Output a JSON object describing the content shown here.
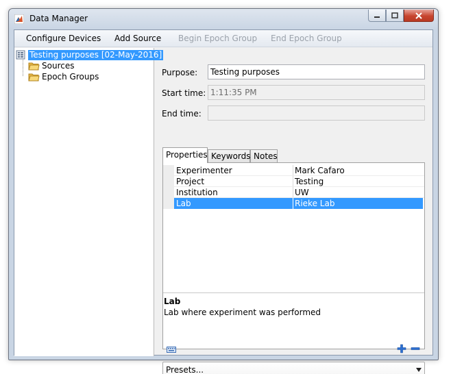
{
  "window": {
    "title": "Data Manager"
  },
  "menu": {
    "configure_devices": "Configure Devices",
    "add_source": "Add Source",
    "begin_epoch_group": "Begin Epoch Group",
    "end_epoch_group": "End Epoch Group"
  },
  "tree": {
    "root": "Testing purposes [02-May-2016]",
    "children": [
      "Sources",
      "Epoch Groups"
    ]
  },
  "form": {
    "purpose_label": "Purpose:",
    "purpose_value": "Testing purposes",
    "start_label": "Start time:",
    "start_value": "1:11:35 PM",
    "end_label": "End time:",
    "end_value": ""
  },
  "tabs": [
    "Properties",
    "Keywords",
    "Notes"
  ],
  "properties": [
    {
      "key": "Experimenter",
      "value": "Mark Cafaro"
    },
    {
      "key": "Project",
      "value": "Testing"
    },
    {
      "key": "Institution",
      "value": "UW"
    },
    {
      "key": "Lab",
      "value": "Rieke Lab"
    }
  ],
  "description": {
    "title": "Lab",
    "text": "Lab where experiment was performed"
  },
  "presets": {
    "selected": "Presets..."
  },
  "colors": {
    "selection": "#3399ff",
    "add": "#2c6fd1"
  }
}
